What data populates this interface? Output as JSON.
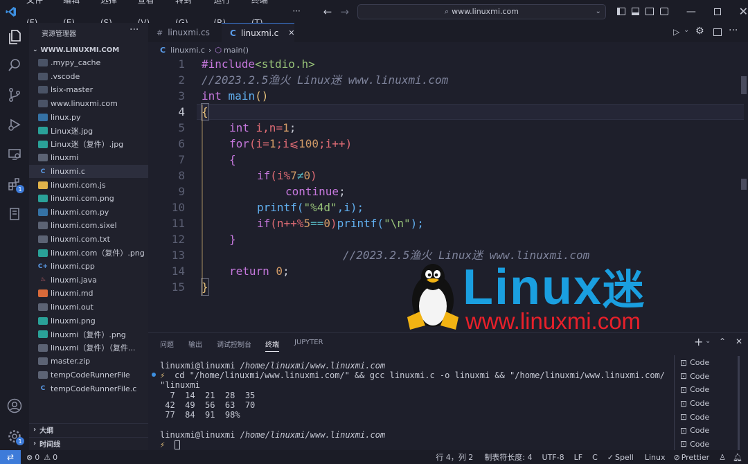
{
  "menu": [
    "文件(F)",
    "编辑(E)",
    "选择(S)",
    "查看(V)",
    "转到(G)",
    "运行(R)",
    "终端(T)",
    "···"
  ],
  "search": {
    "text": "www.linuxmi.com"
  },
  "sidebar": {
    "title": "资源管理器",
    "root": "WWW.LINUXMI.COM",
    "items": [
      {
        "label": ".mypy_cache",
        "kind": "folder"
      },
      {
        "label": ".vscode",
        "kind": "folder"
      },
      {
        "label": "lsix-master",
        "kind": "folder"
      },
      {
        "label": "www.linuxmi.com",
        "kind": "folder"
      },
      {
        "label": "linux.py",
        "kind": "py"
      },
      {
        "label": "Linux迷.jpg",
        "kind": "img"
      },
      {
        "label": "Linux迷（复件）.jpg",
        "kind": "img"
      },
      {
        "label": "linuxmi",
        "kind": "file"
      },
      {
        "label": "linuxmi.c",
        "kind": "c"
      },
      {
        "label": "linuxmi.com.js",
        "kind": "js"
      },
      {
        "label": "linuxmi.com.png",
        "kind": "img"
      },
      {
        "label": "linuxmi.com.py",
        "kind": "py"
      },
      {
        "label": "linuxmi.com.sixel",
        "kind": "file"
      },
      {
        "label": "linuxmi.com.txt",
        "kind": "file"
      },
      {
        "label": "linuxmi.com（复件）.png",
        "kind": "img"
      },
      {
        "label": "linuxmi.cpp",
        "kind": "cpp"
      },
      {
        "label": "linuxmi.java",
        "kind": "java"
      },
      {
        "label": "linuxmi.md",
        "kind": "md"
      },
      {
        "label": "linuxmi.out",
        "kind": "file"
      },
      {
        "label": "linuxmi.png",
        "kind": "img"
      },
      {
        "label": "linuxmi（复件）.png",
        "kind": "img"
      },
      {
        "label": "linuxmi（复件）（复件...",
        "kind": "file"
      },
      {
        "label": "master.zip",
        "kind": "file"
      },
      {
        "label": "tempCodeRunnerFile",
        "kind": "file"
      },
      {
        "label": "tempCodeRunnerFile.c",
        "kind": "c"
      }
    ],
    "outline": "大纲",
    "timeline": "时间线"
  },
  "tabs": [
    {
      "label": "linuxmi.cs",
      "icon": "#"
    },
    {
      "label": "linuxmi.c",
      "icon": "C"
    }
  ],
  "breadcrumb": {
    "file": "linuxmi.c",
    "symbol": "main()"
  },
  "code": {
    "line_numbers": [
      "1",
      "2",
      "3",
      "4",
      "5",
      "6",
      "7",
      "8",
      "9",
      "10",
      "11",
      "12",
      "13",
      "14",
      "15"
    ],
    "l1a": "#include",
    "l1b": "<stdio.h>",
    "l2": "//2023.2.5渔火 Linux迷 www.linuxmi.com",
    "l3a": "int",
    "l3b": "main",
    "l3c": "()",
    "l4": "{",
    "l5a": "int",
    "l5b": " i,n=",
    "l5c": "1",
    "l5d": ";",
    "l6a": "for",
    "l6b": "(i=",
    "l6c": "1",
    "l6d": ";i⩽",
    "l6e": "100",
    "l6f": ";i++)",
    "l7": "{",
    "l8a": "if",
    "l8b": "(i%",
    "l8c": "7",
    "l8d": "≠",
    "l8e": "0",
    "l8f": ")",
    "l9a": "continue",
    "l9b": ";",
    "l10a": "printf",
    "l10b": "(",
    "l10c": "\"%4d\"",
    "l10d": ",i);",
    "l11a": "if",
    "l11b": "(n++%",
    "l11c": "5",
    "l11d": "==",
    "l11e": "0",
    "l11f": ")",
    "l11g": "printf",
    "l11h": "(",
    "l11i": "\"\\n\"",
    "l11j": ");",
    "l12": "}",
    "l13": "//2023.2.5渔火 Linux迷 www.linuxmi.com",
    "l14a": "return",
    "l14b": " 0",
    "l14c": ";",
    "l15": "}"
  },
  "watermark": {
    "brand": "Linux",
    "brand_cn": "迷",
    "url": "www.linuxmi.com"
  },
  "panel": {
    "tabs": [
      "问题",
      "输出",
      "调试控制台",
      "终端",
      "JUPYTER"
    ],
    "terminal": {
      "prompt1_user": "linuxmi@linuxmi",
      "prompt1_path": "/home/linuxmi/www.linuxmi.com",
      "cmd": "cd \"/home/linuxmi/www.linuxmi.com/\" && gcc linuxmi.c -o linuxmi && \"/home/linuxmi/www.linuxmi.com/",
      "cmd_wrap": "\"linuxmi",
      "out1": "  7  14  21  28  35",
      "out2": " 42  49  56  63  70",
      "out3": " 77  84  91  98%",
      "prompt2_user": "linuxmi@linuxmi",
      "prompt2_path": "/home/linuxmi/www.linuxmi.com"
    },
    "terminals": [
      "Code",
      "Code",
      "Code",
      "Code",
      "Code",
      "Code",
      "Code"
    ]
  },
  "status": {
    "errors": "0",
    "warnings": "0",
    "position": "行 4，列 2",
    "indent": "制表符长度: 4",
    "encoding": "UTF-8",
    "eol": "LF",
    "lang": "C",
    "spell": "Spell",
    "os": "Linux",
    "prettier": "Prettier"
  },
  "colors": {
    "accent": "#3d7bd9",
    "brand_blue": "#1a9fe0",
    "brand_red": "#e8202a"
  }
}
